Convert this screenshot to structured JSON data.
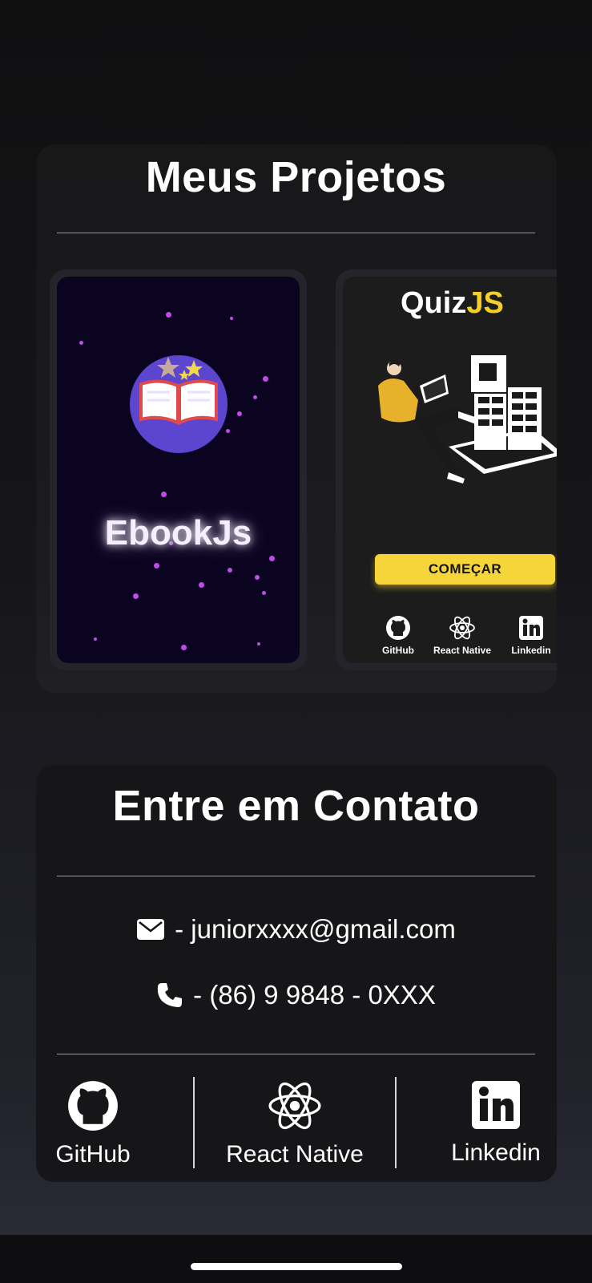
{
  "projects": {
    "title": "Meus Projetos",
    "cards": [
      {
        "name": "EbookJs"
      },
      {
        "name_part1": "Quiz",
        "name_part2": "JS",
        "button": "COMEÇAR",
        "links": [
          "GitHub",
          "React Native",
          "Linkedin"
        ]
      }
    ]
  },
  "contact": {
    "title": "Entre em Contato",
    "email": "- juniorxxxx@gmail.com",
    "phone": "- (86) 9 9848 - 0XXX"
  },
  "social": [
    {
      "label": "GitHub",
      "icon": "github-icon"
    },
    {
      "label": "React Native",
      "icon": "react-icon"
    },
    {
      "label": "Linkedin",
      "icon": "linkedin-icon"
    }
  ],
  "colors": {
    "accent_yellow": "#f3cf2a",
    "ebook_bg": "#0b0420",
    "ebook_circle": "#5c45cf"
  }
}
